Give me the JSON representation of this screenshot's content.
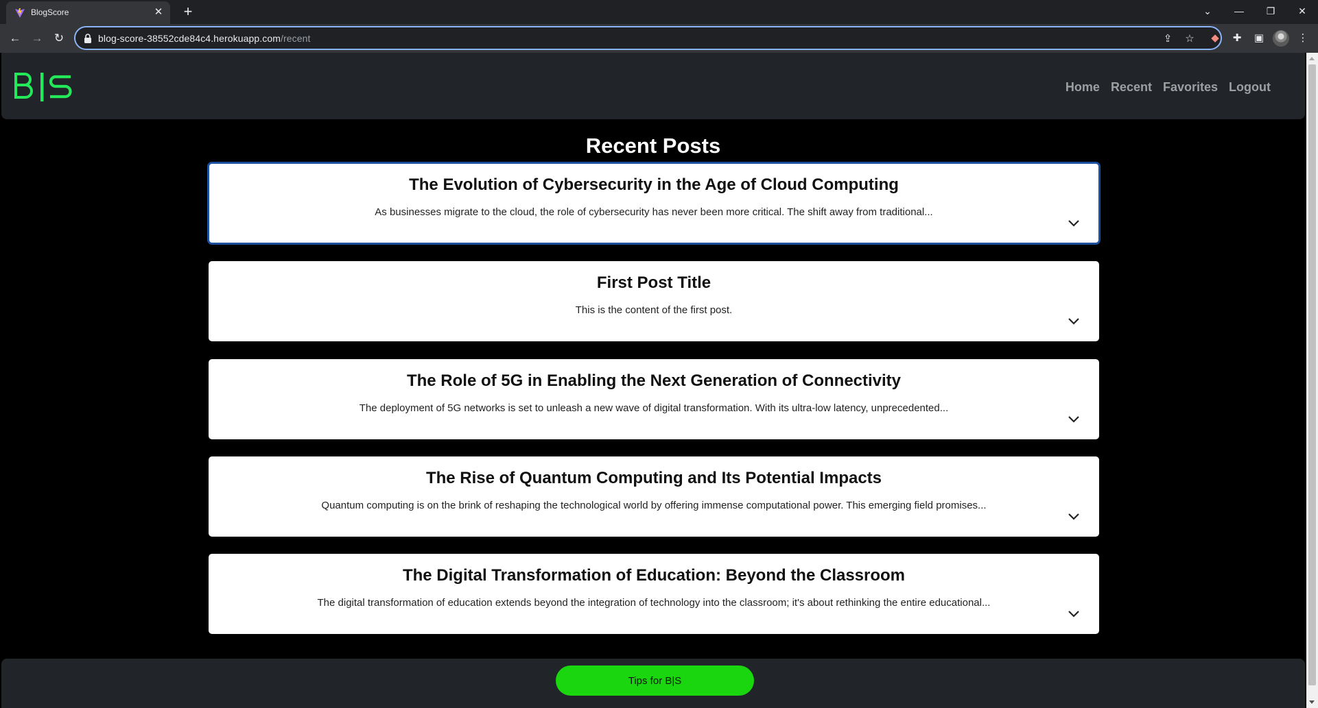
{
  "browser": {
    "tab_title": "BlogScore",
    "url_host": "blog-score-38552cde84c4.herokuapp.com",
    "url_path": "/recent"
  },
  "site": {
    "logo_text": "B|S",
    "nav": [
      "Home",
      "Recent",
      "Favorites",
      "Logout"
    ]
  },
  "main": {
    "title": "Recent Posts",
    "posts": [
      {
        "title": "The Evolution of Cybersecurity in the Age of Cloud Computing",
        "excerpt": "As businesses migrate to the cloud, the role of cybersecurity has never been more critical. The shift away from traditional..."
      },
      {
        "title": "First Post Title",
        "excerpt": "This is the content of the first post."
      },
      {
        "title": "The Role of 5G in Enabling the Next Generation of Connectivity",
        "excerpt": "The deployment of 5G networks is set to unleash a new wave of digital transformation. With its ultra-low latency, unprecedented..."
      },
      {
        "title": "The Rise of Quantum Computing and Its Potential Impacts",
        "excerpt": "Quantum computing is on the brink of reshaping the technological world by offering immense computational power. This emerging field promises..."
      },
      {
        "title": "The Digital Transformation of Education: Beyond the Classroom",
        "excerpt": "The digital transformation of education extends beyond the integration of technology into the classroom; it's about rethinking the entire educational..."
      }
    ]
  },
  "footer": {
    "tips_label": "Tips for B|S"
  },
  "colors": {
    "brand_green": "#1ad60f",
    "logo_green": "#22e85a",
    "navbar_bg": "#212529",
    "active_outline": "#1d4fa0"
  }
}
